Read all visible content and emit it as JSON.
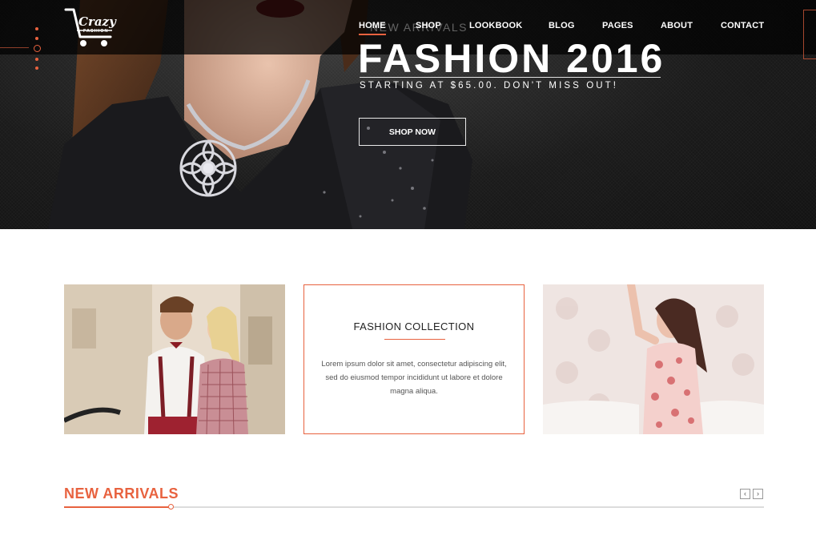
{
  "brand": {
    "logo_text": "Crazy",
    "logo_subtext": "FASHION"
  },
  "nav": {
    "items": [
      {
        "label": "HOME",
        "active": true
      },
      {
        "label": "SHOP",
        "active": false
      },
      {
        "label": "LOOKBOOK",
        "active": false
      },
      {
        "label": "BLOG",
        "active": false
      },
      {
        "label": "PAGES",
        "active": false
      },
      {
        "label": "ABOUT",
        "active": false
      },
      {
        "label": "CONTACT",
        "active": false
      }
    ]
  },
  "hero": {
    "subtitle": "NEW ARRIVALS",
    "title": "FASHION 2016",
    "tagline": "STARTING AT $65.00. DON'T MISS OUT!",
    "button_label": "SHOP NOW"
  },
  "banners": {
    "middle_title": "FASHION COLLECTION",
    "middle_text": "Lorem ipsum dolor sit amet, consectetur adipiscing elit, sed do eiusmod tempor incididunt ut labore et dolore magna aliqua."
  },
  "new_arrivals": {
    "title": "NEW ARRIVALS",
    "prev_icon": "‹",
    "next_icon": "›"
  },
  "colors": {
    "accent": "#e8623f",
    "dark": "#1b1b1b"
  }
}
